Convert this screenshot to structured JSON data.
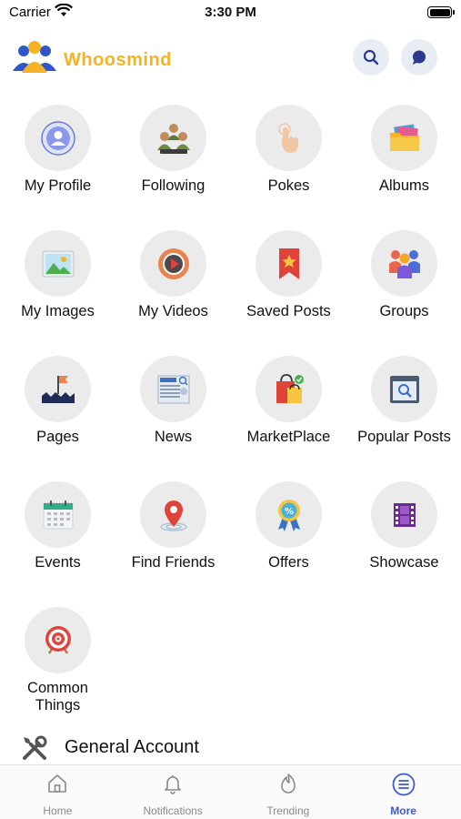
{
  "status": {
    "carrier": "Carrier",
    "time": "3:30 PM"
  },
  "header": {
    "brand": "Whoosmind"
  },
  "menu": [
    {
      "label": "My Profile",
      "icon": "profile-icon"
    },
    {
      "label": "Following",
      "icon": "following-icon"
    },
    {
      "label": "Pokes",
      "icon": "poke-hand-icon"
    },
    {
      "label": "Albums",
      "icon": "albums-folder-icon"
    },
    {
      "label": "My Images",
      "icon": "images-icon"
    },
    {
      "label": "My Videos",
      "icon": "video-play-icon"
    },
    {
      "label": "Saved Posts",
      "icon": "bookmark-star-icon"
    },
    {
      "label": "Groups",
      "icon": "groups-icon"
    },
    {
      "label": "Pages",
      "icon": "flag-icon"
    },
    {
      "label": "News",
      "icon": "news-icon"
    },
    {
      "label": "MarketPlace",
      "icon": "shopping-bag-icon"
    },
    {
      "label": "Popular Posts",
      "icon": "popular-window-icon"
    },
    {
      "label": "Events",
      "icon": "calendar-icon"
    },
    {
      "label": "Find Friends",
      "icon": "location-pin-icon"
    },
    {
      "label": "Offers",
      "icon": "offer-badge-icon"
    },
    {
      "label": "Showcase",
      "icon": "film-icon"
    },
    {
      "label": "Common Things",
      "label_line1": "Common",
      "label_line2": "Things",
      "icon": "target-icon"
    }
  ],
  "general": {
    "label": "General Account",
    "icon": "tools-icon"
  },
  "tabbar": {
    "tabs": [
      {
        "label": "Home",
        "icon": "home-icon",
        "active": false
      },
      {
        "label": "Notifications",
        "icon": "bell-icon",
        "active": false
      },
      {
        "label": "Trending",
        "icon": "flame-icon",
        "active": false
      },
      {
        "label": "More",
        "icon": "menu-lines-icon",
        "active": true
      }
    ]
  },
  "colors": {
    "brand": "#f5b324",
    "accent": "#3d5bd3",
    "tile_bg": "#ebebeb",
    "header_btn_bg": "#e8edf3"
  }
}
